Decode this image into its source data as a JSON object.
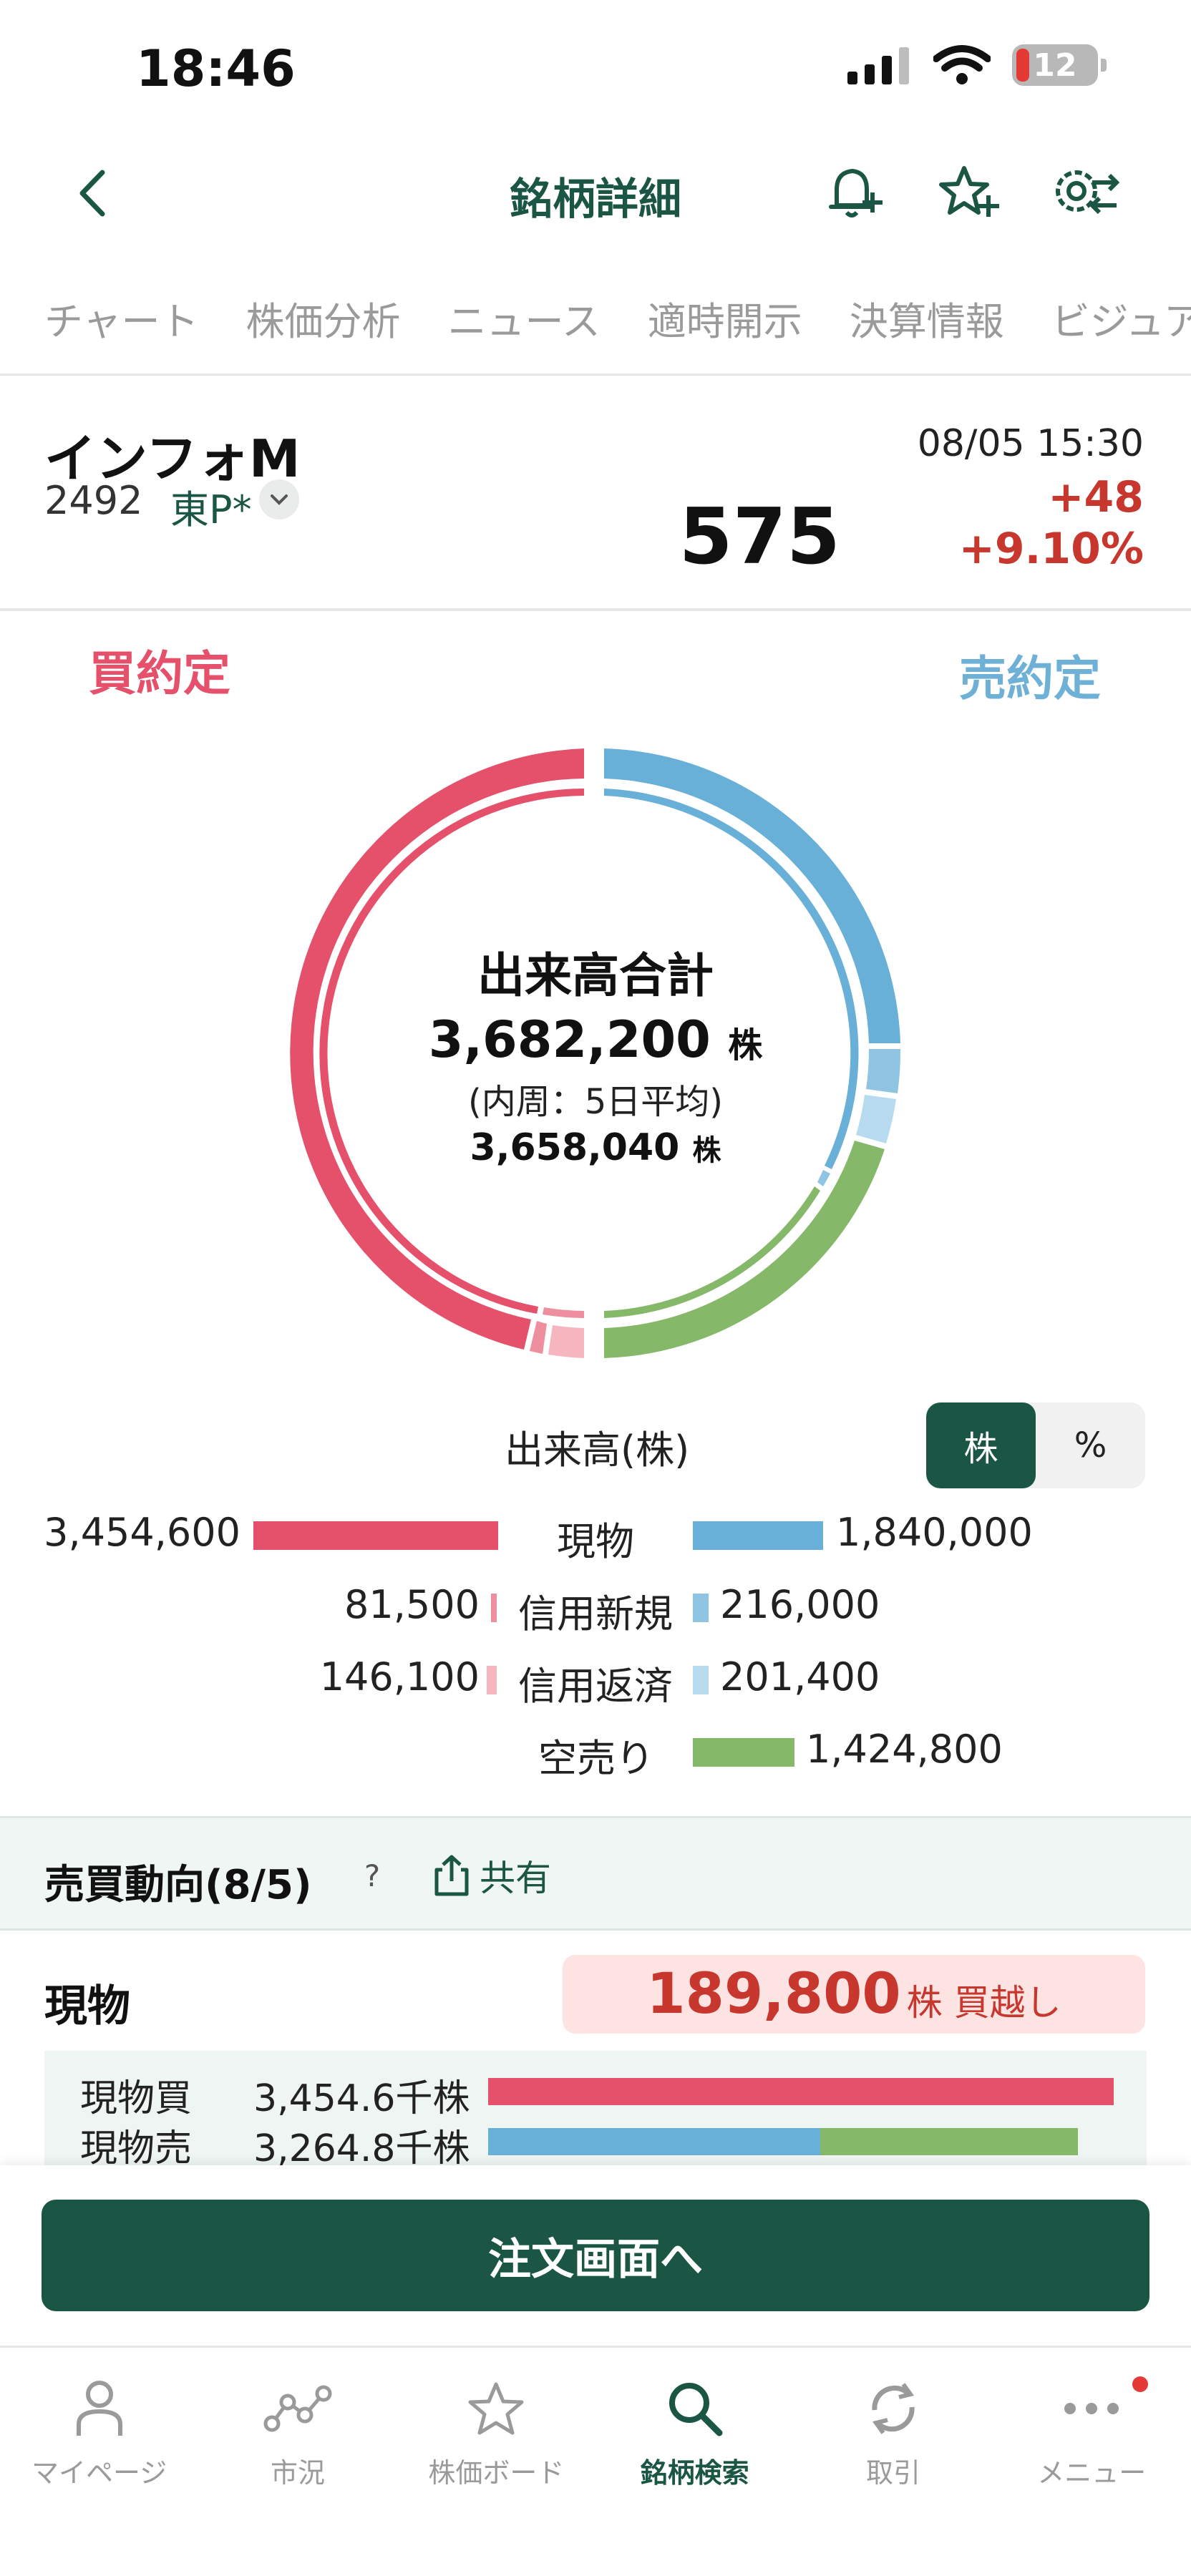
{
  "status_bar": {
    "time": "18:46",
    "battery": "12"
  },
  "header": {
    "title": "銘柄詳細",
    "back_icon": "chevron-left-icon",
    "actions": [
      "bell-plus-icon",
      "star-plus-icon",
      "gear-sliders-icon"
    ]
  },
  "tabs": [
    "チャート",
    "株価分析",
    "ニュース",
    "適時開示",
    "決算情報",
    "ビジュア"
  ],
  "stock": {
    "name": "インフォM",
    "code": "2492",
    "market": "東P*",
    "time": "08/05 15:30",
    "price": "575",
    "change": "+48",
    "change_pct": "+9.10%"
  },
  "donut": {
    "buy_label": "買約定",
    "sell_label": "売約定",
    "title": "出来高合計",
    "total": "3,682,200",
    "unit": "株",
    "sub": "(内周：5日平均)",
    "avg": "3,658,040",
    "colors": {
      "buy_spot": "#e5506a",
      "buy_margin_new": "#ee8f9f",
      "buy_margin_repay": "#f5b6c0",
      "sell_spot": "#68b0d8",
      "sell_margin_new": "#8fc4e2",
      "sell_margin_repay": "#b8daee",
      "short_sell": "#86b86a"
    }
  },
  "volume": {
    "title": "出来高(株)",
    "toggle": [
      "株",
      "%"
    ],
    "rows": [
      {
        "left": "3,454,600",
        "label": "現物",
        "right": "1,840,000"
      },
      {
        "left": "81,500",
        "label": "信用新規",
        "right": "216,000"
      },
      {
        "left": "146,100",
        "label": "信用返済",
        "right": "201,400"
      },
      {
        "left": "",
        "label": "空売り",
        "right": "1,424,800"
      }
    ]
  },
  "trend": {
    "title": "売買動向(8/5)",
    "help": "?",
    "share": "共有"
  },
  "spot": {
    "title": "現物",
    "net_value": "189,800",
    "net_unit": "株 買越し",
    "rows": [
      {
        "label": "現物買",
        "value": "3,454.6千株"
      },
      {
        "label": "現物売",
        "value": "3,264.8千株"
      }
    ]
  },
  "order_button": "注文画面へ",
  "tabbar": [
    {
      "label": "マイページ",
      "icon": "person-icon"
    },
    {
      "label": "市況",
      "icon": "market-graph-icon"
    },
    {
      "label": "株価ボード",
      "icon": "star-outline-icon"
    },
    {
      "label": "銘柄検索",
      "icon": "search-icon"
    },
    {
      "label": "取引",
      "icon": "refresh-cycle-icon"
    },
    {
      "label": "メニュー",
      "icon": "more-dots-icon"
    }
  ]
}
